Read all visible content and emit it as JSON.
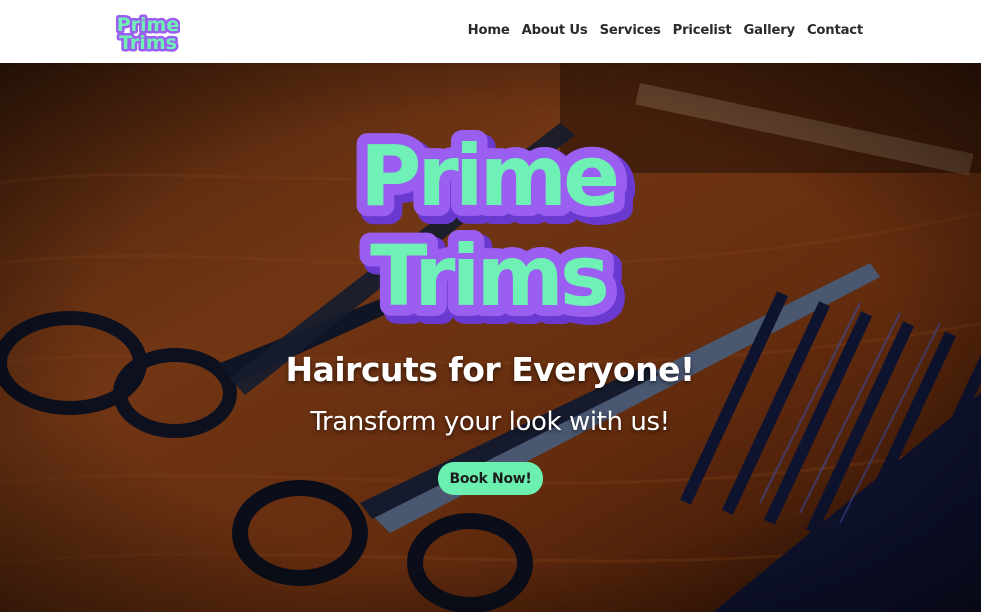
{
  "brand": {
    "line1": "Prime",
    "line2": "Trims",
    "fill_color": "#6ff0b4",
    "outline_color": "#9a5ff0",
    "shadow_color": "#6a3ad0"
  },
  "nav": {
    "items": [
      "Home",
      "About Us",
      "Services",
      "Pricelist",
      "Gallery",
      "Contact"
    ]
  },
  "hero": {
    "headline": "Haircuts for Everyone!",
    "subline": "Transform your look with us!",
    "cta_label": "Book Now!",
    "cta_color": "#6cf0b0",
    "background_image": "barber scissors and comb on wooden table",
    "background_icon": "scissors-and-comb-photo"
  }
}
